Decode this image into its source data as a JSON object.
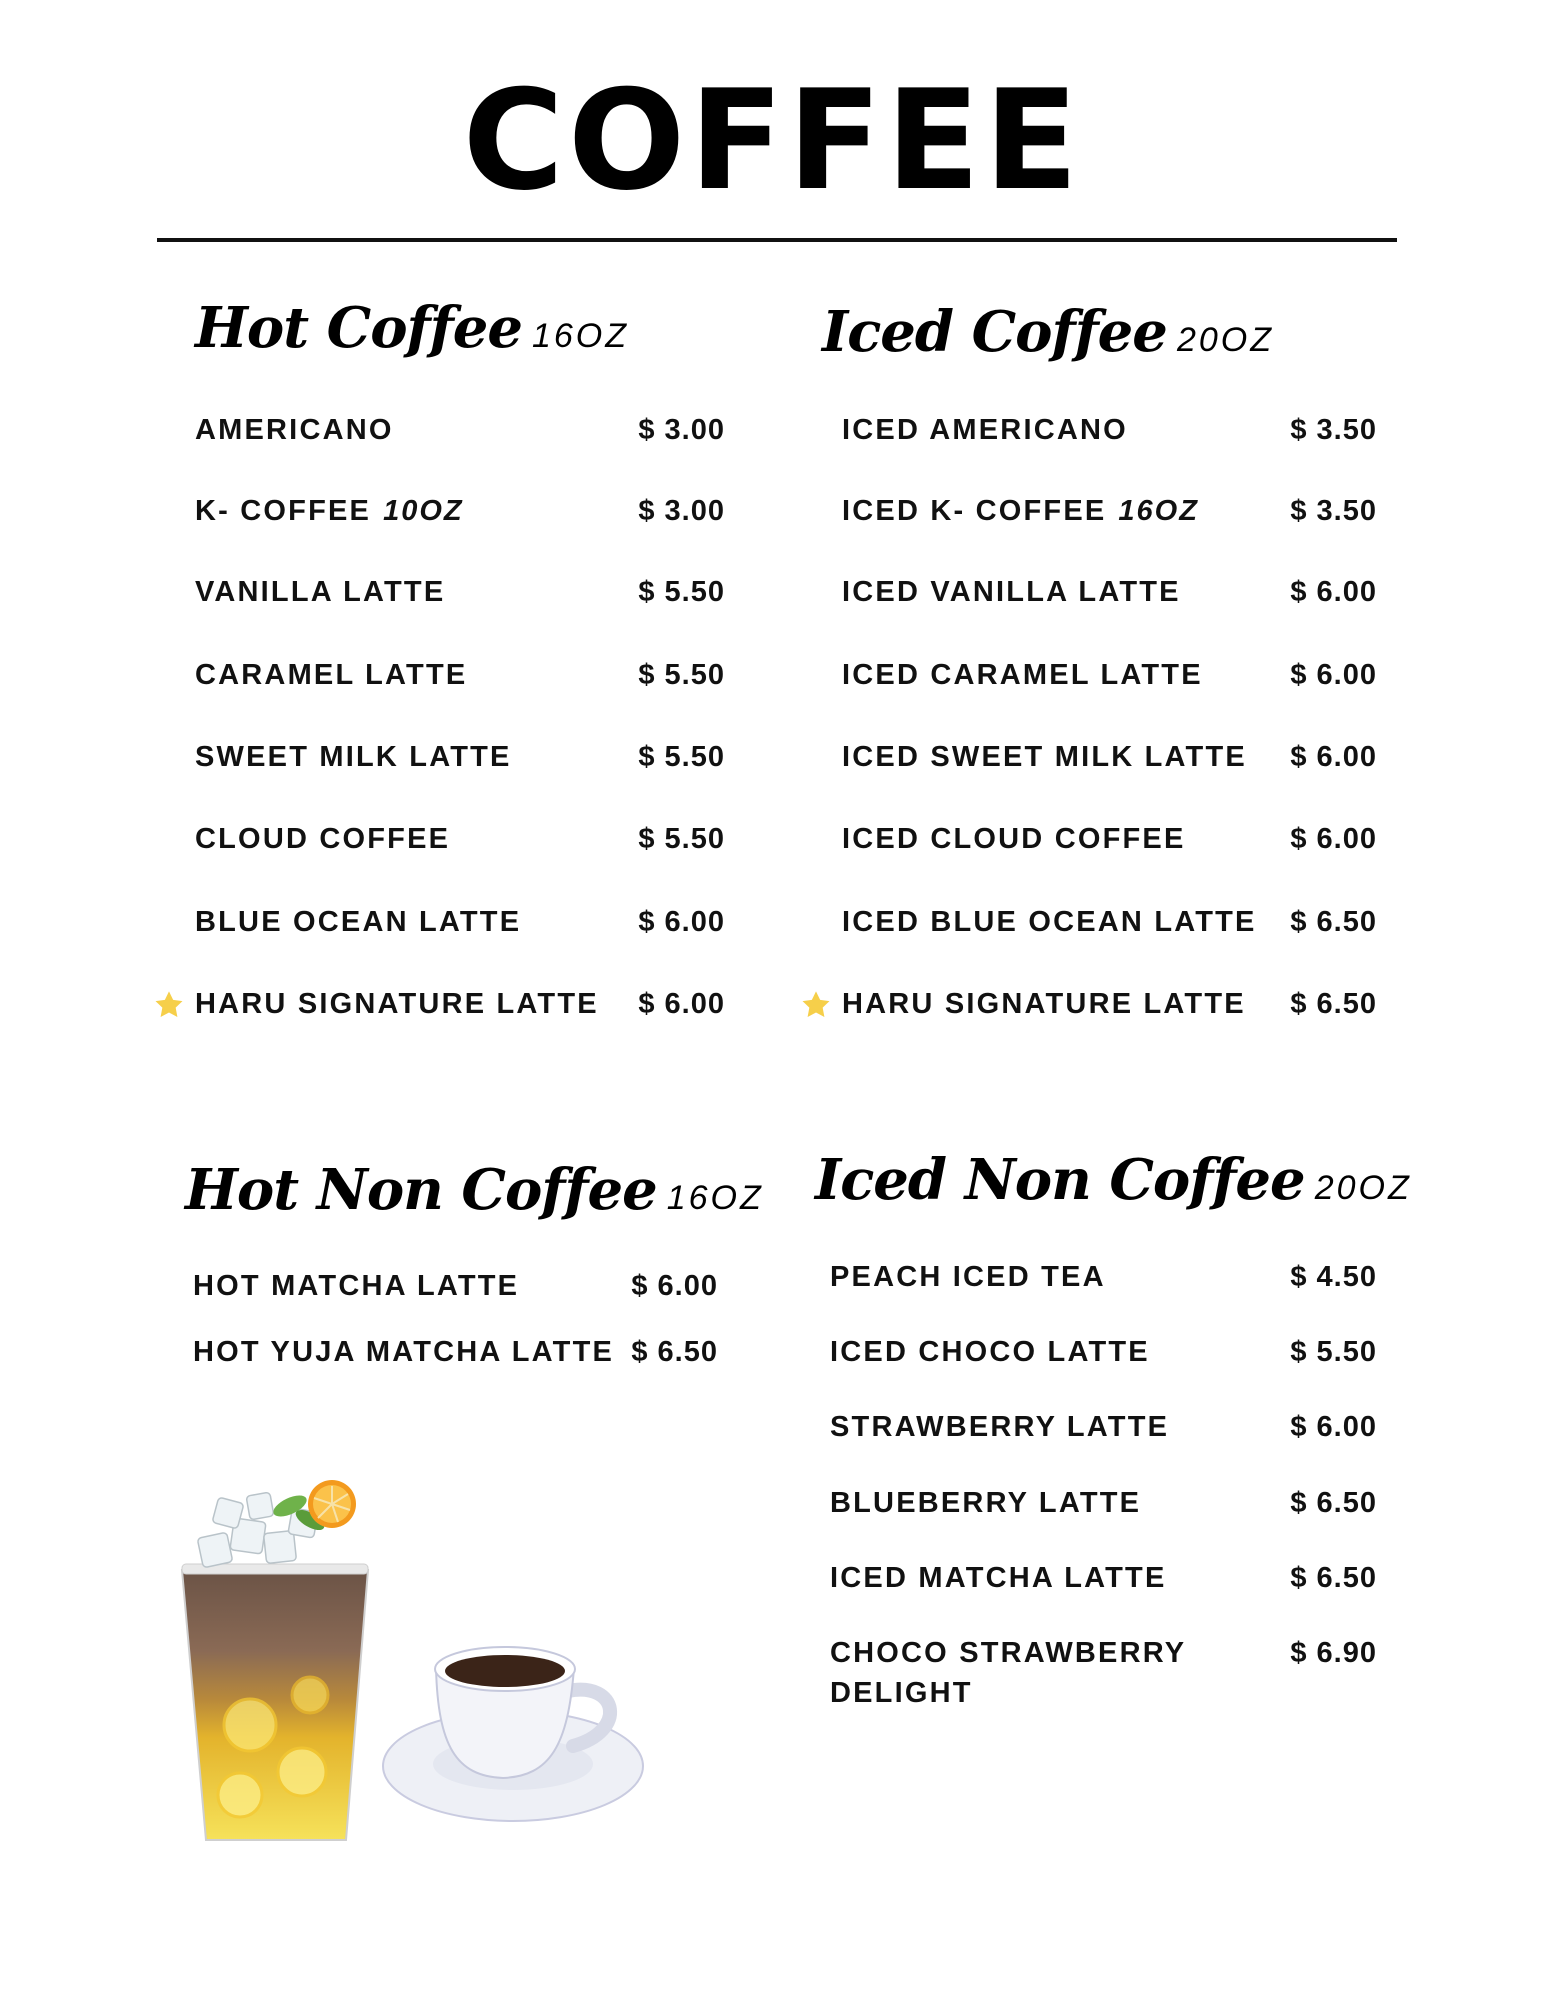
{
  "title": "COFFEE",
  "sections": {
    "hot_coffee": {
      "name": "Hot Coffee",
      "size": "16OZ",
      "items": [
        {
          "name": "AMERICANO",
          "price": "$ 3.00"
        },
        {
          "name": "K- COFFEE",
          "size": "10OZ",
          "price": "$ 3.00"
        },
        {
          "name": "VANILLA LATTE",
          "price": "$ 5.50"
        },
        {
          "name": "CARAMEL LATTE",
          "price": "$ 5.50"
        },
        {
          "name": "SWEET MILK LATTE",
          "price": "$ 5.50"
        },
        {
          "name": "CLOUD COFFEE",
          "price": "$ 5.50"
        },
        {
          "name": "BLUE OCEAN LATTE",
          "price": "$ 6.00"
        },
        {
          "name": "HARU SIGNATURE LATTE",
          "price": "$ 6.00",
          "icon": "star-icon"
        }
      ]
    },
    "iced_coffee": {
      "name": "Iced Coffee",
      "size": "20OZ",
      "items": [
        {
          "name": "ICED AMERICANO",
          "price": "$ 3.50"
        },
        {
          "name": "ICED K- COFFEE",
          "size": "16OZ",
          "price": "$ 3.50"
        },
        {
          "name": "ICED VANILLA LATTE",
          "price": "$ 6.00"
        },
        {
          "name": "ICED CARAMEL LATTE",
          "price": "$ 6.00"
        },
        {
          "name": "ICED SWEET MILK LATTE",
          "price": "$ 6.00"
        },
        {
          "name": "ICED CLOUD COFFEE",
          "price": "$ 6.00"
        },
        {
          "name": "ICED BLUE OCEAN LATTE",
          "price": "$ 6.50"
        },
        {
          "name": "HARU SIGNATURE LATTE",
          "price": "$ 6.50",
          "icon": "star-icon"
        }
      ]
    },
    "hot_non_coffee": {
      "name": "Hot Non Coffee",
      "size": "16OZ",
      "items": [
        {
          "name": "HOT MATCHA LATTE",
          "price": "$ 6.00"
        },
        {
          "name": "HOT YUJA MATCHA LATTE",
          "price": "$ 6.50"
        }
      ]
    },
    "iced_non_coffee": {
      "name": "Iced Non Coffee",
      "size": "20OZ",
      "items": [
        {
          "name": "PEACH ICED TEA",
          "price": "$ 4.50"
        },
        {
          "name": "ICED CHOCO LATTE",
          "price": "$ 5.50"
        },
        {
          "name": "STRAWBERRY LATTE",
          "price": "$ 6.00"
        },
        {
          "name": "BLUEBERRY LATTE",
          "price": "$ 6.50"
        },
        {
          "name": "ICED MATCHA LATTE",
          "price": "$ 6.50"
        },
        {
          "name": "CHOCO STRAWBERRY",
          "name_line2": "DELIGHT",
          "price": "$ 6.90"
        }
      ]
    }
  },
  "star_color": "#f6cf4a"
}
